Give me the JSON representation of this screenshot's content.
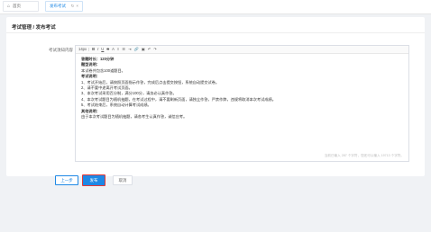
{
  "tabs": [
    {
      "label": "首页",
      "icon": "home-icon"
    },
    {
      "label": "发布考试",
      "icon": "",
      "actions": [
        "↻",
        "×"
      ]
    }
  ],
  "card": {
    "title": "考试管理 / 发布考试",
    "field_label": "考试须知内容"
  },
  "editor": {
    "toolbar": {
      "font_size": "14px",
      "bold": "B",
      "italic": "I",
      "underline": "U",
      "strike": "S",
      "color": "A",
      "list": "≡",
      "align": "☰",
      "indent": "⇥",
      "link": "🔗",
      "image": "▣",
      "undo": "↶",
      "redo": "↷"
    },
    "lines": [
      {
        "text": "答题时长：120分钟",
        "bold": true
      },
      {
        "text": "题型说明：",
        "bold": true
      },
      {
        "text": "本试卷共包含100道题目。",
        "bold": false
      },
      {
        "text": "考试说明：",
        "bold": true
      },
      {
        "text": "1、考试开始后，请按照页面指示作答，完成后点击提交按钮，系统自动提交试卷。",
        "bold": false
      },
      {
        "text": "2、请不要中途离开考试页面。",
        "bold": false
      },
      {
        "text": "3、本次考试采用百分制，满分100分，请务必认真作答。",
        "bold": false
      },
      {
        "text": "4、本次考试题目为随机抽题，在考试过程中，请不要刷新页面，请独立作答，严禁作弊，违规将取消本次考试成绩。",
        "bold": false
      },
      {
        "text": "5、考试结束后，系统自动计算考试成绩。",
        "bold": false
      },
      {
        "text": "其他说明：",
        "bold": true
      },
      {
        "text": "由于本次考试题目为随机抽题，请各考生认真作答，诚信应考。",
        "bold": false
      }
    ],
    "footer": "当前已输入 287 个字符，您还可以输入 19713 个字符。"
  },
  "buttons": {
    "prev": "上一步",
    "submit": "发布",
    "cancel": "取消"
  }
}
